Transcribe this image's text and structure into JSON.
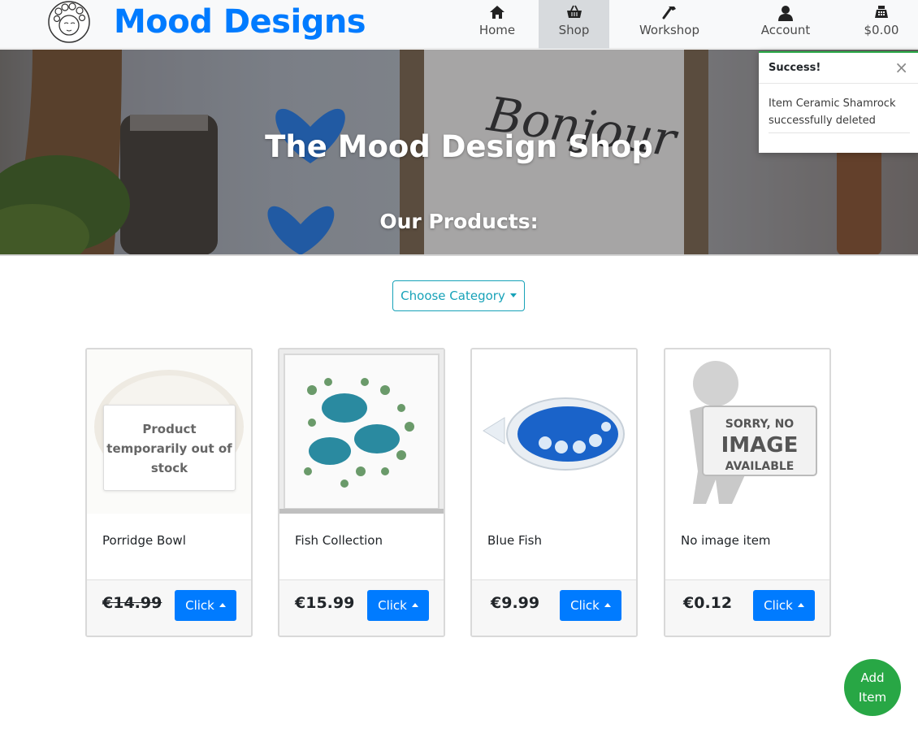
{
  "brand": {
    "word1": "Mood",
    "word2": "Designs"
  },
  "nav": {
    "home": "Home",
    "shop": "Shop",
    "workshop": "Workshop",
    "account": "Account",
    "cart": "$0.00"
  },
  "hero": {
    "title": "The Mood Design Shop",
    "subtitle": "Our Products:",
    "sign_text": "Bonjour"
  },
  "toast": {
    "title": "Success!",
    "close": "×",
    "message": "Item Ceramic Shamrock successfully deleted"
  },
  "category": {
    "label": "Choose Category"
  },
  "products": [
    {
      "name": "Porridge Bowl",
      "price": "€14.99",
      "button": "Click",
      "out_of_stock": "Product temporarily out of stock"
    },
    {
      "name": "Fish Collection",
      "price": "€15.99",
      "button": "Click"
    },
    {
      "name": "Blue Fish",
      "price": "€9.99",
      "button": "Click"
    },
    {
      "name": "No image item",
      "price": "€0.12",
      "button": "Click",
      "placeholder": {
        "line1": "SORRY, NO",
        "line2": "IMAGE",
        "line3": "AVAILABLE"
      }
    }
  ],
  "fab": {
    "line1": "Add",
    "line2": "Item"
  },
  "colors": {
    "primary": "#007bff",
    "success": "#28a745",
    "info": "#17a2b8"
  }
}
